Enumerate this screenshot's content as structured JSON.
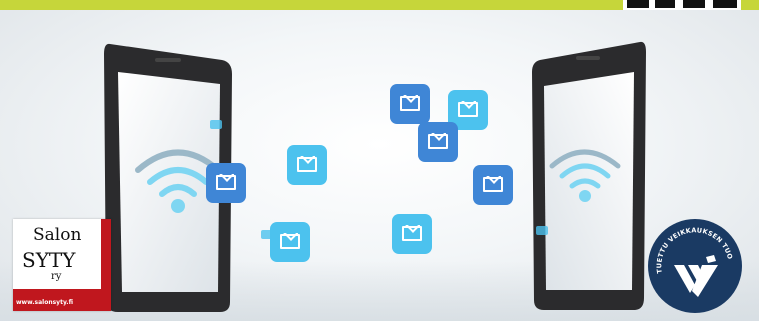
{
  "scene": {
    "description_colors": {
      "accent_top_bar": "#c6d63a",
      "envelope_light": "#4cc2ee",
      "envelope_dark": "#3f86d6",
      "salon_red": "#c0171e",
      "badge_navy": "#1a3a63"
    }
  },
  "logos": {
    "salon": {
      "line1": "Salon",
      "line2": "SYTY",
      "line3": "ry",
      "url": "www.salonsyty.fi"
    },
    "veikkaus": {
      "arc_text": "TUETTU VEIKKAUKSEN TUOTOILLA"
    }
  },
  "icons": {
    "envelope": "envelope-icon",
    "wifi": "wifi-icon"
  }
}
